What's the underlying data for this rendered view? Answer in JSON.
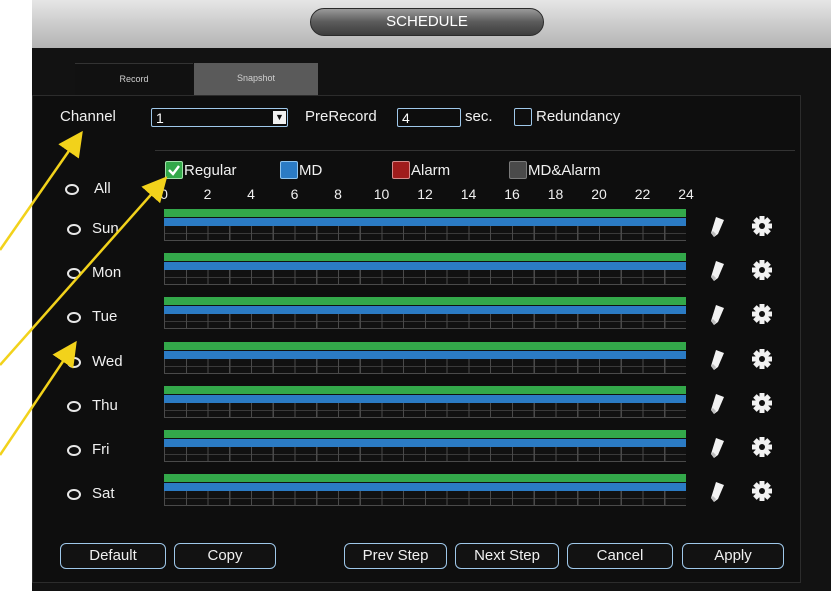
{
  "window": {
    "title": "SCHEDULE"
  },
  "tabs": [
    {
      "label": "Record"
    },
    {
      "label": "Snapshot"
    }
  ],
  "form": {
    "channel_label": "Channel",
    "channel_value": "1",
    "prerecord_label": "PreRecord",
    "prerecord_value": "4",
    "sec_label": "sec.",
    "redundancy_label": "Redundancy"
  },
  "legend": [
    {
      "label": "Regular",
      "color": "#33a84a",
      "checked": true
    },
    {
      "label": "MD",
      "color": "#2b7bc4",
      "checked": false
    },
    {
      "label": "Alarm",
      "color": "#a01c1c",
      "checked": false
    },
    {
      "label": "MD&Alarm",
      "color": "#4a4a4a",
      "checked": false
    }
  ],
  "timeline": {
    "hours": [
      "0",
      "2",
      "4",
      "6",
      "8",
      "10",
      "12",
      "14",
      "16",
      "18",
      "20",
      "22",
      "24"
    ]
  },
  "all_label": "All",
  "days": [
    {
      "label": "Sun"
    },
    {
      "label": "Mon"
    },
    {
      "label": "Tue"
    },
    {
      "label": "Wed"
    },
    {
      "label": "Thu"
    },
    {
      "label": "Fri"
    },
    {
      "label": "Sat"
    }
  ],
  "icons": {
    "edit": "pencil-icon",
    "settings": "gear-icon"
  },
  "buttons": {
    "default": "Default",
    "copy": "Copy",
    "prev": "Prev Step",
    "next": "Next Step",
    "cancel": "Cancel",
    "apply": "Apply"
  }
}
